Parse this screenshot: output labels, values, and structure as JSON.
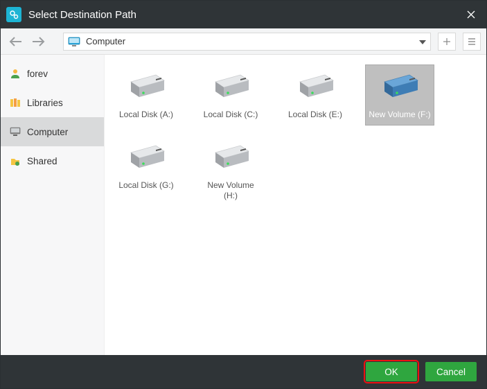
{
  "window": {
    "title": "Select Destination Path"
  },
  "toolbar": {
    "location": "Computer"
  },
  "sidebar": {
    "items": [
      {
        "label": "forev"
      },
      {
        "label": "Libraries"
      },
      {
        "label": "Computer"
      },
      {
        "label": "Shared"
      }
    ]
  },
  "drives": [
    {
      "label": "Local Disk (A:)",
      "color": "light"
    },
    {
      "label": "Local Disk (C:)",
      "color": "light"
    },
    {
      "label": "Local Disk (E:)",
      "color": "light"
    },
    {
      "label": "New Volume (F:)",
      "color": "blue",
      "selected": true
    },
    {
      "label": "Local Disk (G:)",
      "color": "light"
    },
    {
      "label": "New Volume (H:)",
      "color": "light"
    }
  ],
  "footer": {
    "ok": "OK",
    "cancel": "Cancel"
  }
}
